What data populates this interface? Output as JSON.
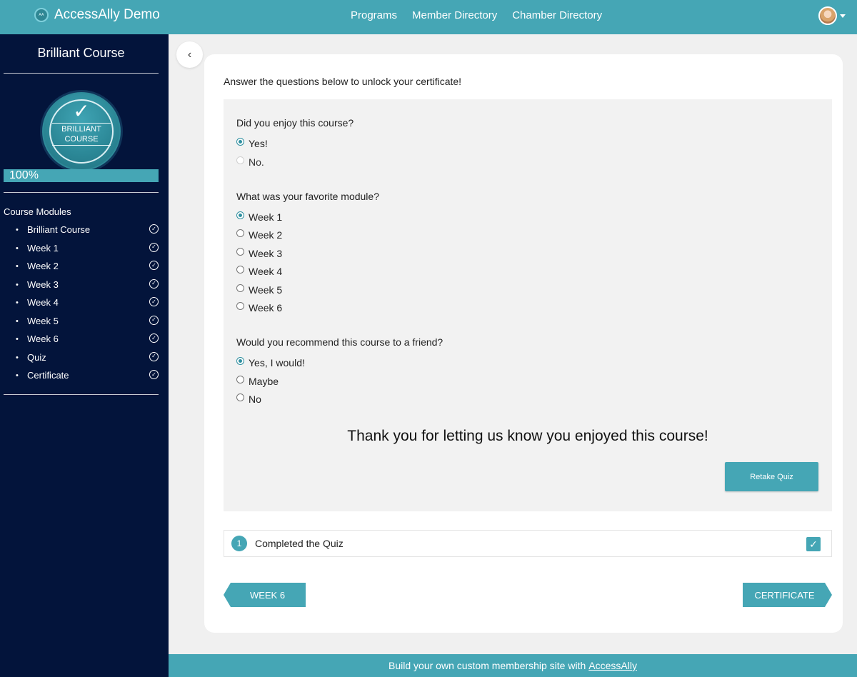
{
  "header": {
    "brand": "AccessAlly Demo",
    "brand_logo_text": "AA",
    "nav": [
      "Programs",
      "Member Directory",
      "Chamber Directory"
    ]
  },
  "sidebar": {
    "course_title": "Brilliant Course",
    "badge": {
      "line1": "BRILLIANT",
      "line2": "COURSE"
    },
    "progress": {
      "label": "100%",
      "value": 1.0
    },
    "modules_heading": "Course Modules",
    "modules": [
      {
        "label": "Brilliant Course",
        "completed": true
      },
      {
        "label": "Week 1",
        "completed": true
      },
      {
        "label": "Week 2",
        "completed": true
      },
      {
        "label": "Week 3",
        "completed": true
      },
      {
        "label": "Week 4",
        "completed": true
      },
      {
        "label": "Week 5",
        "completed": true
      },
      {
        "label": "Week 6",
        "completed": true
      },
      {
        "label": "Quiz",
        "completed": true
      },
      {
        "label": "Certificate",
        "completed": true
      }
    ]
  },
  "main": {
    "intro": "Answer the questions below to unlock your certificate!",
    "questions": [
      {
        "text": "Did you enjoy this course?",
        "options": [
          {
            "label": "Yes!",
            "selected": true,
            "disabled": false
          },
          {
            "label": "No.",
            "selected": false,
            "disabled": true
          }
        ]
      },
      {
        "text": "What was your favorite module?",
        "options": [
          {
            "label": "Week 1",
            "selected": true,
            "disabled": false
          },
          {
            "label": "Week 2",
            "selected": false,
            "disabled": false
          },
          {
            "label": "Week 3",
            "selected": false,
            "disabled": false
          },
          {
            "label": "Week 4",
            "selected": false,
            "disabled": false
          },
          {
            "label": "Week 5",
            "selected": false,
            "disabled": false
          },
          {
            "label": "Week 6",
            "selected": false,
            "disabled": false
          }
        ]
      },
      {
        "text": "Would you recommend this course to a friend?",
        "options": [
          {
            "label": "Yes, I would!",
            "selected": true,
            "disabled": false
          },
          {
            "label": "Maybe",
            "selected": false,
            "disabled": false
          },
          {
            "label": "No",
            "selected": false,
            "disabled": false
          }
        ]
      }
    ],
    "thanks": "Thank you for letting us know you enjoyed this course!",
    "retake_label": "Retake Quiz",
    "task": {
      "number": "1",
      "label": "Completed the Quiz",
      "checked": true
    },
    "prev_label": "WEEK 6",
    "next_label": "CERTIFICATE"
  },
  "footer": {
    "text": "Build your own custom membership site with",
    "link": "AccessAlly"
  },
  "colors": {
    "accent": "#45a6b5",
    "sidebar_bg": "#03143b",
    "page_bg": "#f0f0f0",
    "quiz_bg": "#f2f2f2"
  }
}
